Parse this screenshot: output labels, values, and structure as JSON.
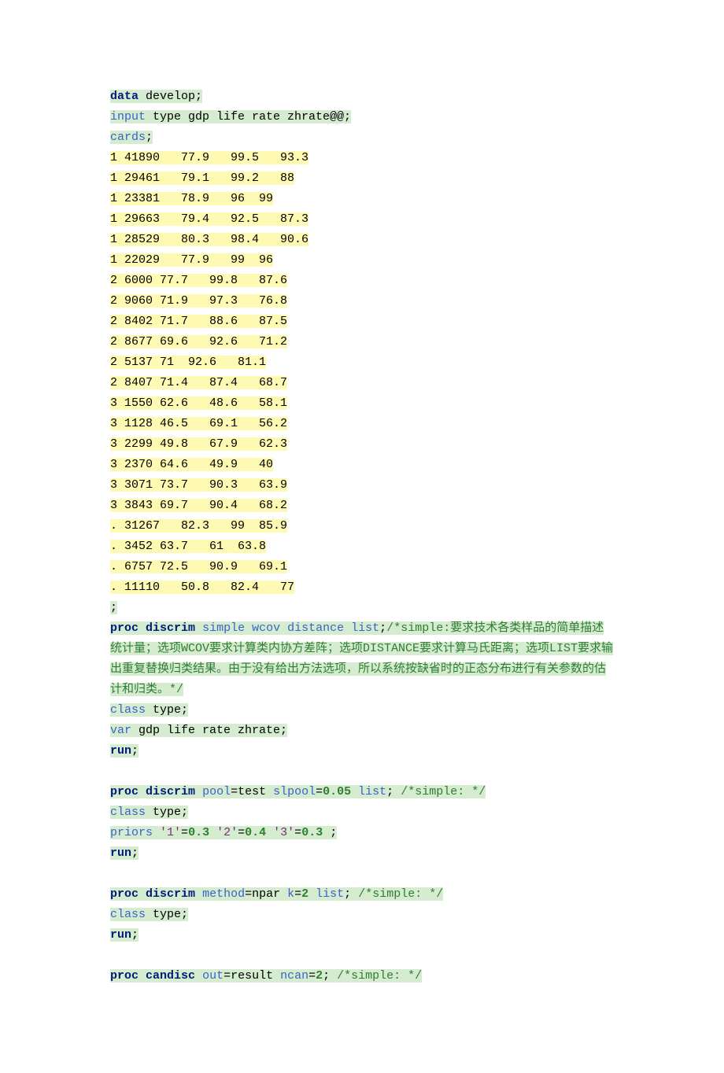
{
  "lines": [
    {
      "cls": "hl",
      "segs": [
        {
          "t": "data",
          "c": "kw"
        },
        {
          "t": " develop;",
          "c": "tx"
        }
      ]
    },
    {
      "cls": "hl",
      "segs": [
        {
          "t": "input",
          "c": "fn"
        },
        {
          "t": " type gdp life rate zhrate@@;",
          "c": "tx"
        }
      ]
    },
    {
      "cls": "hl",
      "segs": [
        {
          "t": "cards",
          "c": "fn"
        },
        {
          "t": ";",
          "c": "tx"
        }
      ]
    },
    {
      "cls": "hl-y",
      "segs": [
        {
          "t": "1 41890   77.9   99.5   93.3",
          "c": "tx"
        }
      ]
    },
    {
      "cls": "hl-y",
      "segs": [
        {
          "t": "1 29461   79.1   99.2   88",
          "c": "tx"
        }
      ]
    },
    {
      "cls": "hl-y",
      "segs": [
        {
          "t": "1 23381   78.9   96  99",
          "c": "tx"
        }
      ]
    },
    {
      "cls": "hl-y",
      "segs": [
        {
          "t": "1 29663   79.4   92.5   87.3",
          "c": "tx"
        }
      ]
    },
    {
      "cls": "hl-y",
      "segs": [
        {
          "t": "1 28529   80.3   98.4   90.6",
          "c": "tx"
        }
      ]
    },
    {
      "cls": "hl-y",
      "segs": [
        {
          "t": "1 22029   77.9   99  96",
          "c": "tx"
        }
      ]
    },
    {
      "cls": "hl-y",
      "segs": [
        {
          "t": "2 6000 77.7   99.8   87.6",
          "c": "tx"
        }
      ]
    },
    {
      "cls": "hl-y",
      "segs": [
        {
          "t": "2 9060 71.9   97.3   76.8",
          "c": "tx"
        }
      ]
    },
    {
      "cls": "hl-y",
      "segs": [
        {
          "t": "2 8402 71.7   88.6   87.5",
          "c": "tx"
        }
      ]
    },
    {
      "cls": "hl-y",
      "segs": [
        {
          "t": "2 8677 69.6   92.6   71.2",
          "c": "tx"
        }
      ]
    },
    {
      "cls": "hl-y",
      "segs": [
        {
          "t": "2 5137 71  92.6   81.1",
          "c": "tx"
        }
      ]
    },
    {
      "cls": "hl-y",
      "segs": [
        {
          "t": "2 8407 71.4   87.4   68.7",
          "c": "tx"
        }
      ]
    },
    {
      "cls": "hl-y",
      "segs": [
        {
          "t": "3 1550 62.6   48.6   58.1",
          "c": "tx"
        }
      ]
    },
    {
      "cls": "hl-y",
      "segs": [
        {
          "t": "3 1128 46.5   69.1   56.2",
          "c": "tx"
        }
      ]
    },
    {
      "cls": "hl-y",
      "segs": [
        {
          "t": "3 2299 49.8   67.9   62.3",
          "c": "tx"
        }
      ]
    },
    {
      "cls": "hl-y",
      "segs": [
        {
          "t": "3 2370 64.6   49.9   40",
          "c": "tx"
        }
      ]
    },
    {
      "cls": "hl-y",
      "segs": [
        {
          "t": "3 3071 73.7   90.3   63.9",
          "c": "tx"
        }
      ]
    },
    {
      "cls": "hl-y",
      "segs": [
        {
          "t": "3 3843 69.7   90.4   68.2",
          "c": "tx"
        }
      ]
    },
    {
      "cls": "hl-y",
      "segs": [
        {
          "t": ". 31267   82.3   99  85.9",
          "c": "tx"
        }
      ]
    },
    {
      "cls": "hl-y",
      "segs": [
        {
          "t": ". 3452 63.7   61  63.8",
          "c": "tx"
        }
      ]
    },
    {
      "cls": "hl-y",
      "segs": [
        {
          "t": ". 6757 72.5   90.9   69.1",
          "c": "tx"
        }
      ]
    },
    {
      "cls": "hl-y",
      "segs": [
        {
          "t": ". 11110   50.8   82.4   77",
          "c": "tx"
        }
      ]
    },
    {
      "cls": "hl",
      "segs": [
        {
          "t": ";",
          "c": "tx"
        }
      ]
    },
    {
      "cls": "hl",
      "segs": [
        {
          "t": "proc",
          "c": "kw"
        },
        {
          "t": " ",
          "c": "tx"
        },
        {
          "t": "discrim",
          "c": "kw"
        },
        {
          "t": " ",
          "c": "tx"
        },
        {
          "t": "simple",
          "c": "fn"
        },
        {
          "t": " ",
          "c": "tx"
        },
        {
          "t": "wcov",
          "c": "fn"
        },
        {
          "t": " ",
          "c": "tx"
        },
        {
          "t": "distance",
          "c": "fn"
        },
        {
          "t": " ",
          "c": "tx"
        },
        {
          "t": "list",
          "c": "fn"
        },
        {
          "t": ";",
          "c": "tx"
        },
        {
          "t": "/*simple:要求技术各类样品的简单描述统计量；选项WCOV要求计算类内协方差阵；选项DISTANCE要求计算马氏距离；选项LIST要求输出重复替换归类结果。由于没有给出方法选项，所以系统按缺省时的正态分布进行有关参数的估计和归类。*/",
          "c": "cm"
        }
      ]
    },
    {
      "cls": "hl",
      "segs": [
        {
          "t": "class",
          "c": "fn"
        },
        {
          "t": " type;",
          "c": "tx"
        }
      ]
    },
    {
      "cls": "hl",
      "segs": [
        {
          "t": "var",
          "c": "fn"
        },
        {
          "t": " gdp life rate zhrate;",
          "c": "tx"
        }
      ]
    },
    {
      "cls": "hl",
      "segs": [
        {
          "t": "run",
          "c": "kw"
        },
        {
          "t": ";",
          "c": "tx"
        }
      ]
    },
    {
      "cls": "",
      "segs": [
        {
          "t": " ",
          "c": "tx"
        }
      ]
    },
    {
      "cls": "hl",
      "segs": [
        {
          "t": "proc",
          "c": "kw"
        },
        {
          "t": " ",
          "c": "tx"
        },
        {
          "t": "discrim",
          "c": "kw"
        },
        {
          "t": " ",
          "c": "tx"
        },
        {
          "t": "pool",
          "c": "fn"
        },
        {
          "t": "=test ",
          "c": "tx"
        },
        {
          "t": "slpool",
          "c": "fn"
        },
        {
          "t": "=",
          "c": "tx"
        },
        {
          "t": "0.05",
          "c": "num"
        },
        {
          "t": " ",
          "c": "tx"
        },
        {
          "t": "list",
          "c": "fn"
        },
        {
          "t": "; ",
          "c": "tx"
        },
        {
          "t": "/*simple: */",
          "c": "cm"
        }
      ]
    },
    {
      "cls": "hl",
      "segs": [
        {
          "t": "class",
          "c": "fn"
        },
        {
          "t": " type;",
          "c": "tx"
        }
      ]
    },
    {
      "cls": "hl",
      "segs": [
        {
          "t": "priors",
          "c": "fn"
        },
        {
          "t": " ",
          "c": "tx"
        },
        {
          "t": "'1'",
          "c": "str"
        },
        {
          "t": "=",
          "c": "tx"
        },
        {
          "t": "0.3",
          "c": "num"
        },
        {
          "t": " ",
          "c": "tx"
        },
        {
          "t": "'2'",
          "c": "str"
        },
        {
          "t": "=",
          "c": "tx"
        },
        {
          "t": "0.4",
          "c": "num"
        },
        {
          "t": " ",
          "c": "tx"
        },
        {
          "t": "'3'",
          "c": "str"
        },
        {
          "t": "=",
          "c": "tx"
        },
        {
          "t": "0.3",
          "c": "num"
        },
        {
          "t": " ;",
          "c": "tx"
        }
      ]
    },
    {
      "cls": "hl",
      "segs": [
        {
          "t": "run",
          "c": "kw"
        },
        {
          "t": ";",
          "c": "tx"
        }
      ]
    },
    {
      "cls": "",
      "segs": [
        {
          "t": " ",
          "c": "tx"
        }
      ]
    },
    {
      "cls": "hl",
      "segs": [
        {
          "t": "proc",
          "c": "kw"
        },
        {
          "t": " ",
          "c": "tx"
        },
        {
          "t": "discrim",
          "c": "kw"
        },
        {
          "t": " ",
          "c": "tx"
        },
        {
          "t": "method",
          "c": "fn"
        },
        {
          "t": "=npar ",
          "c": "tx"
        },
        {
          "t": "k",
          "c": "fn"
        },
        {
          "t": "=",
          "c": "tx"
        },
        {
          "t": "2",
          "c": "num"
        },
        {
          "t": " ",
          "c": "tx"
        },
        {
          "t": "list",
          "c": "fn"
        },
        {
          "t": "; ",
          "c": "tx"
        },
        {
          "t": "/*simple: */",
          "c": "cm"
        }
      ]
    },
    {
      "cls": "hl",
      "segs": [
        {
          "t": "class",
          "c": "fn"
        },
        {
          "t": " type;",
          "c": "tx"
        }
      ]
    },
    {
      "cls": "hl",
      "segs": [
        {
          "t": "run",
          "c": "kw"
        },
        {
          "t": ";",
          "c": "tx"
        }
      ]
    },
    {
      "cls": "",
      "segs": [
        {
          "t": " ",
          "c": "tx"
        }
      ]
    },
    {
      "cls": "hl",
      "segs": [
        {
          "t": "proc",
          "c": "kw"
        },
        {
          "t": " ",
          "c": "tx"
        },
        {
          "t": "candisc",
          "c": "kw"
        },
        {
          "t": " ",
          "c": "tx"
        },
        {
          "t": "out",
          "c": "fn"
        },
        {
          "t": "=result ",
          "c": "tx"
        },
        {
          "t": "ncan",
          "c": "fn"
        },
        {
          "t": "=",
          "c": "tx"
        },
        {
          "t": "2",
          "c": "num"
        },
        {
          "t": "; ",
          "c": "tx"
        },
        {
          "t": "/*simple: */",
          "c": "cm"
        }
      ]
    }
  ]
}
